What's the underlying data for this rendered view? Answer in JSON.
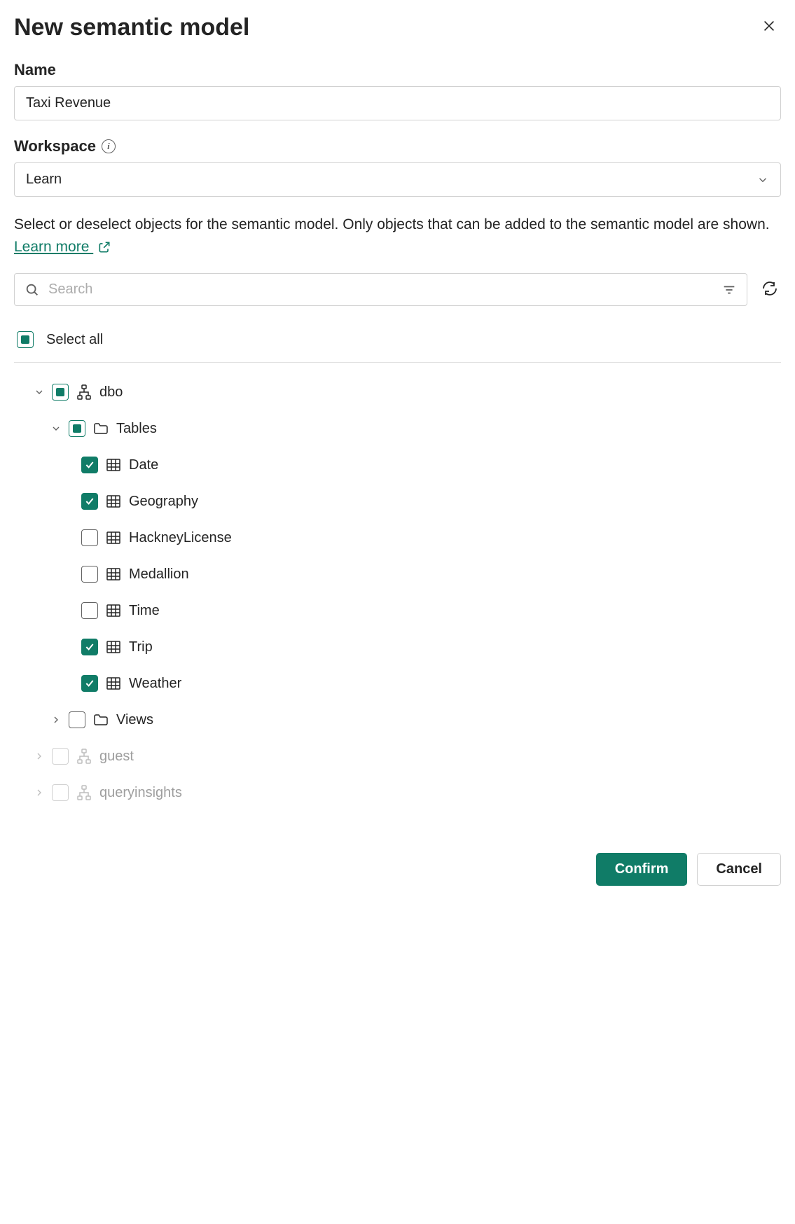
{
  "title": "New semantic model",
  "name_field": {
    "label": "Name",
    "value": "Taxi Revenue"
  },
  "workspace_field": {
    "label": "Workspace",
    "value": "Learn"
  },
  "description": {
    "text": "Select or deselect objects for the semantic model. Only objects that can be added to the semantic model are shown. ",
    "link_text": "Learn more "
  },
  "search": {
    "placeholder": "Search"
  },
  "select_all_label": "Select all",
  "tree": {
    "dbo": {
      "label": "dbo",
      "tables_label": "Tables",
      "tables": [
        {
          "label": "Date",
          "checked": true
        },
        {
          "label": "Geography",
          "checked": true
        },
        {
          "label": "HackneyLicense",
          "checked": false
        },
        {
          "label": "Medallion",
          "checked": false
        },
        {
          "label": "Time",
          "checked": false
        },
        {
          "label": "Trip",
          "checked": true
        },
        {
          "label": "Weather",
          "checked": true
        }
      ],
      "views_label": "Views"
    },
    "guest": {
      "label": "guest"
    },
    "queryinsights": {
      "label": "queryinsights"
    }
  },
  "footer": {
    "confirm": "Confirm",
    "cancel": "Cancel"
  }
}
